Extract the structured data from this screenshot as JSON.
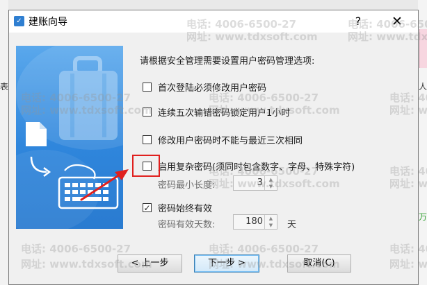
{
  "window": {
    "title": "建账向导",
    "help_label": "?",
    "close_label": "✕"
  },
  "background": {
    "left_char": "表",
    "right_chars": [
      "人",
      "万"
    ]
  },
  "wizard": {
    "heading": "请根据安全管理需要设置用户密码管理选项:",
    "options": [
      {
        "label": "首次登陆必须修改用户密码",
        "checked": false
      },
      {
        "label": "连续五次输错密码锁定用户1小时",
        "checked": false
      },
      {
        "label": "修改用户密码时不能与最近三次相同",
        "checked": false
      },
      {
        "label": "启用复杂密码(须同时包含数字、字母、特殊字符)",
        "checked": false
      },
      {
        "label": "密码始终有效",
        "checked": true
      }
    ],
    "min_length": {
      "label": "密码最小长度:",
      "value": "3"
    },
    "valid_days": {
      "label": "密码有效天数:",
      "value": "180",
      "unit": "天"
    }
  },
  "buttons": {
    "back": "< 上一步",
    "next": "下一步 >",
    "cancel": "取消(C)"
  },
  "watermark": {
    "phone": "电话: 4006-6500-27",
    "site": "网址: www.tdxsoft.com"
  },
  "colors": {
    "highlight": "#e0201e",
    "art_blue": "#2f86dc"
  },
  "icons": [
    "app-icon",
    "briefcase-icon",
    "document-icon",
    "keyboard-icon",
    "arrow-icon"
  ]
}
